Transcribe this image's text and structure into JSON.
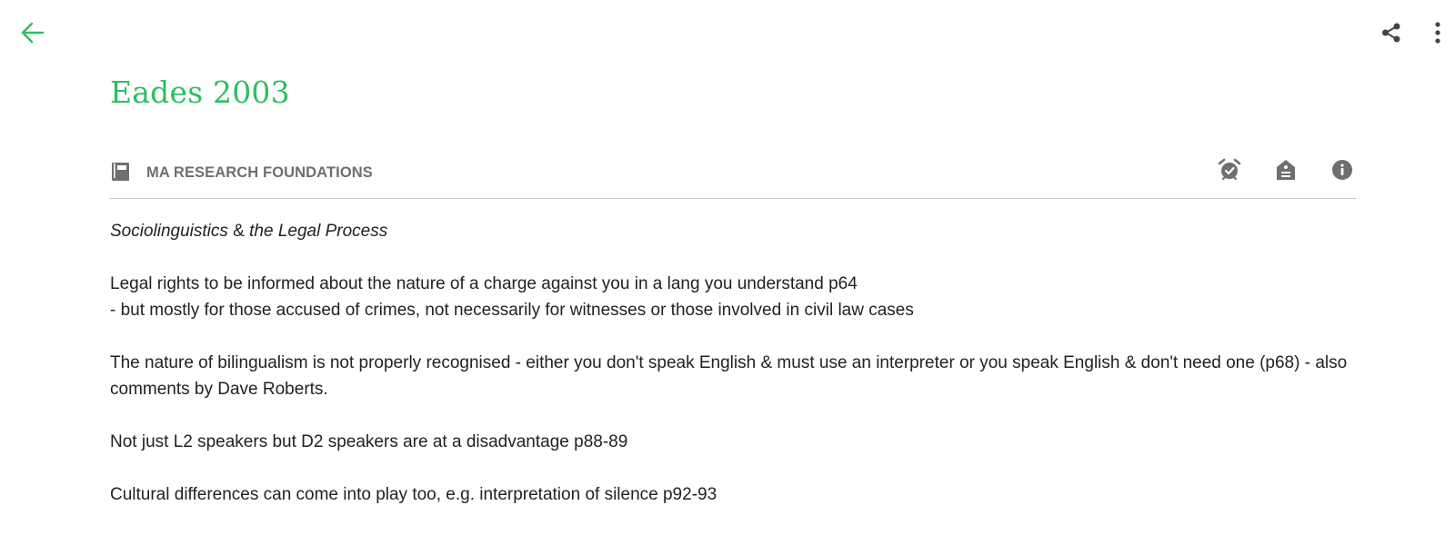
{
  "header": {
    "back_icon": "arrow-left-icon",
    "share_icon": "share-icon",
    "more_icon": "more-vertical-icon"
  },
  "note": {
    "title": "Eades 2003",
    "notebook": {
      "icon": "notebook-icon",
      "name": "MA RESEARCH FOUNDATIONS"
    },
    "actions": {
      "reminder_icon": "alarm-check-icon",
      "tag_icon": "tag-icon",
      "info_icon": "info-icon"
    },
    "body": {
      "subtitle_italic_1": "Sociolinguistics",
      "subtitle_amp": " & ",
      "subtitle_italic_2": "the Legal Process",
      "para1_line1": "Legal rights to be informed about the nature of a charge against you in a lang you understand p64",
      "para1_line2": "- but mostly for those accused of crimes, not necessarily for witnesses or those involved in civil law cases",
      "para2": "The nature of bilingualism is not properly recognised - either you don't speak English & must use an interpreter or you speak English & don't need one (p68) - also comments by Dave Roberts.",
      "para3": "Not just L2 speakers but D2 speakers are at a disadvantage p88-89",
      "para4": "Cultural differences can come into play too, e.g. interpretation of silence p92-93"
    }
  },
  "colors": {
    "accent": "#2dbe60",
    "icon_gray": "#6f6f6f",
    "text": "#222222",
    "divider": "#c8c8c8"
  }
}
